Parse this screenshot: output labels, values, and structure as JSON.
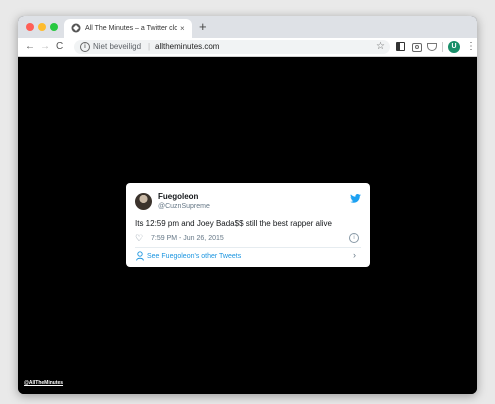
{
  "browser": {
    "tab_title": "All The Minutes – a Twitter clo",
    "tab_close": "×",
    "new_tab": "+",
    "back": "←",
    "forward": "→",
    "reload": "C",
    "security_label": "Niet beveiligd",
    "url_separator": "|",
    "url": "alltheminutes.com",
    "star": "☆",
    "avatar_letter": "U",
    "menu": "⋮"
  },
  "tweet": {
    "name": "Fuegoleon",
    "handle": "@CuznSupreme",
    "text": "Its 12:59 pm and Joey Bada$$ still the best rapper alive",
    "heart": "♡",
    "timestamp": "7:59 PM - Jun 26, 2015",
    "info": "i",
    "see_more": "See Fuegoleon's other Tweets",
    "chevron": "›"
  },
  "footer": {
    "link": "@AllTheMinutes"
  },
  "colors": {
    "twitter_blue": "#1da1f2",
    "link_blue": "#1b95e0",
    "page_bg": "#000000"
  }
}
